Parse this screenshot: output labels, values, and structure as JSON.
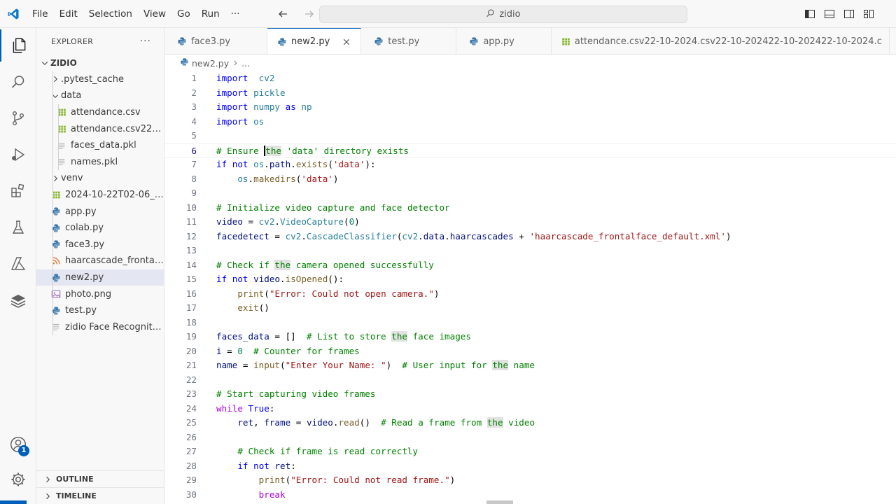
{
  "menubar": [
    "File",
    "Edit",
    "Selection",
    "View",
    "Go",
    "Run",
    "···"
  ],
  "command_center": {
    "text": "zidio"
  },
  "explorer": {
    "title": "EXPLORER",
    "more": "···",
    "root": "ZIDIO",
    "items": [
      {
        "label": ".pytest_cache",
        "type": "folder",
        "collapsed": true,
        "level": 1
      },
      {
        "label": "data",
        "type": "folder",
        "collapsed": false,
        "level": 1
      },
      {
        "label": "attendance.csv",
        "type": "csv",
        "level": 2
      },
      {
        "label": "attendance.csv22-1...",
        "type": "csv",
        "level": 2
      },
      {
        "label": "faces_data.pkl",
        "type": "plain",
        "level": 2
      },
      {
        "label": "names.pkl",
        "type": "plain",
        "level": 2
      },
      {
        "label": "venv",
        "type": "folder",
        "collapsed": true,
        "level": 1
      },
      {
        "label": "2024-10-22T02-06_ex...",
        "type": "csv",
        "level": 1
      },
      {
        "label": "app.py",
        "type": "python",
        "level": 1
      },
      {
        "label": "colab.py",
        "type": "python",
        "level": 1
      },
      {
        "label": "face3.py",
        "type": "python",
        "level": 1
      },
      {
        "label": "haarcascade_frontalfa...",
        "type": "rss",
        "level": 1
      },
      {
        "label": "new2.py",
        "type": "python",
        "level": 1,
        "selected": true
      },
      {
        "label": "photo.png",
        "type": "image",
        "level": 1
      },
      {
        "label": "test.py",
        "type": "python",
        "level": 1
      },
      {
        "label": "zidio Face Recognitio...",
        "type": "plain",
        "level": 1
      }
    ],
    "outline": "OUTLINE",
    "timeline": "TIMELINE"
  },
  "accounts_badge": "1",
  "tabs": [
    {
      "label": "face3.py",
      "type": "python",
      "active": false
    },
    {
      "label": "new2.py",
      "type": "python",
      "active": true
    },
    {
      "label": "test.py",
      "type": "python",
      "active": false
    },
    {
      "label": "app.py",
      "type": "python",
      "active": false
    },
    {
      "label": "attendance.csv22-10-2024.csv22-10-202422-10-202422-10-2024.c",
      "type": "csv",
      "active": false
    }
  ],
  "breadcrumb": {
    "file": "new2.py",
    "more": "..."
  },
  "editor": {
    "current_line": 6,
    "lines": [
      [
        [
          "kw",
          "import"
        ],
        [
          "",
          "  "
        ],
        [
          "mod",
          "cv2"
        ]
      ],
      [
        [
          "kw",
          "import"
        ],
        [
          "",
          " "
        ],
        [
          "mod",
          "pickle"
        ]
      ],
      [
        [
          "kw",
          "import"
        ],
        [
          "",
          " "
        ],
        [
          "mod",
          "numpy"
        ],
        [
          "",
          " "
        ],
        [
          "kw",
          "as"
        ],
        [
          "",
          " "
        ],
        [
          "mod",
          "np"
        ]
      ],
      [
        [
          "kw",
          "import"
        ],
        [
          "",
          " "
        ],
        [
          "mod",
          "os"
        ]
      ],
      [],
      [
        [
          "com",
          "# Ensure "
        ],
        [
          "comhl",
          "the"
        ],
        [
          "com",
          " 'data' directory exists"
        ]
      ],
      [
        [
          "kw",
          "if"
        ],
        [
          "",
          " "
        ],
        [
          "kw",
          "not"
        ],
        [
          "",
          " "
        ],
        [
          "mod",
          "os"
        ],
        [
          "op",
          "."
        ],
        [
          "var",
          "path"
        ],
        [
          "op",
          "."
        ],
        [
          "fn",
          "exists"
        ],
        [
          "op",
          "("
        ],
        [
          "str",
          "'data'"
        ],
        [
          "op",
          "):"
        ]
      ],
      [
        [
          "",
          "    "
        ],
        [
          "mod",
          "os"
        ],
        [
          "op",
          "."
        ],
        [
          "fn",
          "makedirs"
        ],
        [
          "op",
          "("
        ],
        [
          "str",
          "'data'"
        ],
        [
          "op",
          ")"
        ]
      ],
      [],
      [
        [
          "com",
          "# Initialize video capture and face detector"
        ]
      ],
      [
        [
          "var",
          "video"
        ],
        [
          "op",
          " = "
        ],
        [
          "mod",
          "cv2"
        ],
        [
          "op",
          "."
        ],
        [
          "mod",
          "VideoCapture"
        ],
        [
          "op",
          "("
        ],
        [
          "num",
          "0"
        ],
        [
          "op",
          ")"
        ]
      ],
      [
        [
          "var",
          "facedetect"
        ],
        [
          "op",
          " = "
        ],
        [
          "mod",
          "cv2"
        ],
        [
          "op",
          "."
        ],
        [
          "mod",
          "CascadeClassifier"
        ],
        [
          "op",
          "("
        ],
        [
          "mod",
          "cv2"
        ],
        [
          "op",
          "."
        ],
        [
          "var",
          "data"
        ],
        [
          "op",
          "."
        ],
        [
          "var",
          "haarcascades"
        ],
        [
          "op",
          " + "
        ],
        [
          "str",
          "'haarcascade_frontalface_default.xml'"
        ],
        [
          "op",
          ")"
        ]
      ],
      [],
      [
        [
          "com",
          "# Check if "
        ],
        [
          "comhl",
          "the"
        ],
        [
          "com",
          " camera opened successfully"
        ]
      ],
      [
        [
          "kw",
          "if"
        ],
        [
          "",
          " "
        ],
        [
          "kw",
          "not"
        ],
        [
          "",
          " "
        ],
        [
          "var",
          "video"
        ],
        [
          "op",
          "."
        ],
        [
          "fn",
          "isOpened"
        ],
        [
          "op",
          "():"
        ]
      ],
      [
        [
          "",
          "    "
        ],
        [
          "fn",
          "print"
        ],
        [
          "op",
          "("
        ],
        [
          "str",
          "\"Error: Could not open camera.\""
        ],
        [
          "op",
          ")"
        ]
      ],
      [
        [
          "",
          "    "
        ],
        [
          "fn",
          "exit"
        ],
        [
          "op",
          "()"
        ]
      ],
      [],
      [
        [
          "var",
          "faces_data"
        ],
        [
          "op",
          " = []  "
        ],
        [
          "com",
          "# List to store "
        ],
        [
          "comhl",
          "the"
        ],
        [
          "com",
          " face images"
        ]
      ],
      [
        [
          "var",
          "i"
        ],
        [
          "op",
          " = "
        ],
        [
          "num",
          "0"
        ],
        [
          "op",
          "  "
        ],
        [
          "com",
          "# Counter for frames"
        ]
      ],
      [
        [
          "var",
          "name"
        ],
        [
          "op",
          " = "
        ],
        [
          "fn",
          "input"
        ],
        [
          "op",
          "("
        ],
        [
          "str",
          "\"Enter Your Name: \""
        ],
        [
          "op",
          ")  "
        ],
        [
          "com",
          "# User input for "
        ],
        [
          "comhl",
          "the"
        ],
        [
          "com",
          " name"
        ]
      ],
      [],
      [
        [
          "com",
          "# Start capturing video frames"
        ]
      ],
      [
        [
          "ctl",
          "while"
        ],
        [
          "",
          " "
        ],
        [
          "kw",
          "True"
        ],
        [
          "op",
          ":"
        ]
      ],
      [
        [
          "",
          "    "
        ],
        [
          "var",
          "ret"
        ],
        [
          "op",
          ", "
        ],
        [
          "var",
          "frame"
        ],
        [
          "op",
          " = "
        ],
        [
          "var",
          "video"
        ],
        [
          "op",
          "."
        ],
        [
          "fn",
          "read"
        ],
        [
          "op",
          "()  "
        ],
        [
          "com",
          "# Read a frame from "
        ],
        [
          "comhl",
          "the"
        ],
        [
          "com",
          " video"
        ]
      ],
      [],
      [
        [
          "",
          "    "
        ],
        [
          "com",
          "# Check if frame is read correctly"
        ]
      ],
      [
        [
          "",
          "    "
        ],
        [
          "kw",
          "if"
        ],
        [
          "",
          " "
        ],
        [
          "kw",
          "not"
        ],
        [
          "",
          " "
        ],
        [
          "var",
          "ret"
        ],
        [
          "op",
          ":"
        ]
      ],
      [
        [
          "",
          "        "
        ],
        [
          "fn",
          "print"
        ],
        [
          "op",
          "("
        ],
        [
          "str",
          "\"Error: Could not read frame.\""
        ],
        [
          "op",
          ")"
        ]
      ],
      [
        [
          "",
          "        "
        ],
        [
          "ctl",
          "break"
        ]
      ]
    ]
  }
}
